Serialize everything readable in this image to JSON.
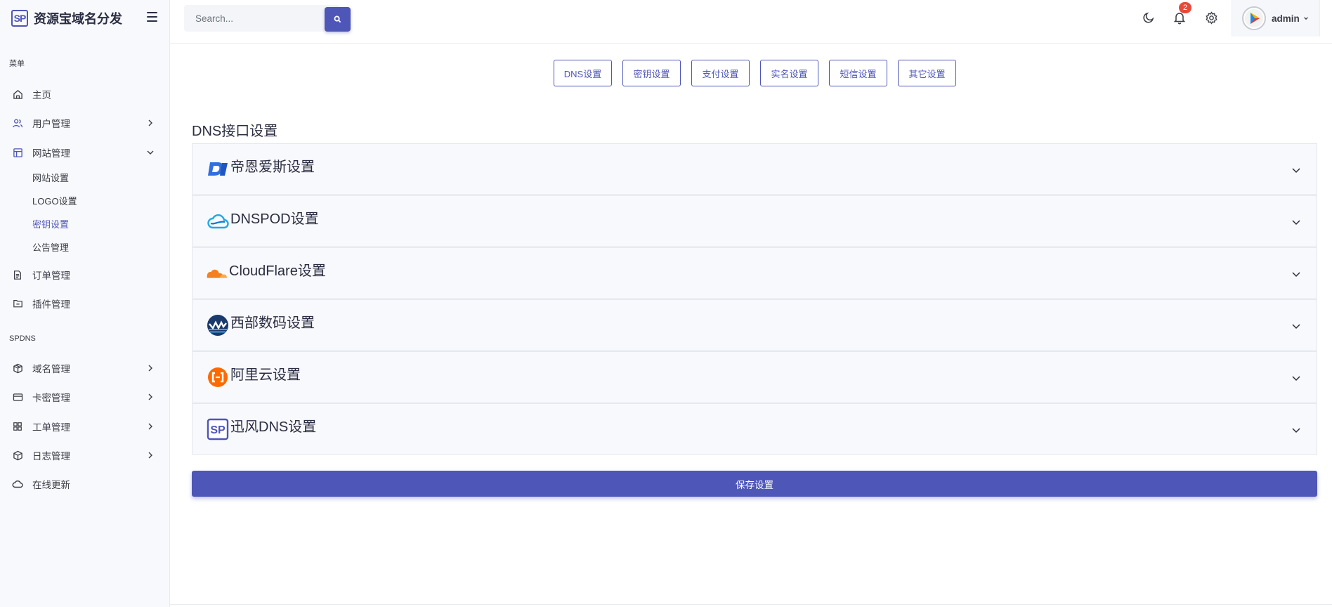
{
  "brand": {
    "logo_text": "SP",
    "title": "资源宝域名分发"
  },
  "sidebar": {
    "section_menu": "菜单",
    "section_spdns": "SPDNS",
    "items": {
      "home": "主页",
      "users": "用户管理",
      "site": "网站管理",
      "orders": "订单管理",
      "plugins": "插件管理",
      "domains": "域名管理",
      "cards": "卡密管理",
      "tickets": "工单管理",
      "logs": "日志管理",
      "update": "在线更新"
    },
    "site_sub": {
      "site_settings": "网站设置",
      "logo_settings": "LOGO设置",
      "key_settings": "密钥设置",
      "notice": "公告管理"
    }
  },
  "header": {
    "search_placeholder": "Search...",
    "notification_count": "2",
    "username": "admin"
  },
  "tabs": [
    "DNS设置",
    "密钥设置",
    "支付设置",
    "实名设置",
    "短信设置",
    "其它设置"
  ],
  "section_title": "DNS接口设置",
  "providers": [
    "帝恩爱斯设置",
    "DNSPOD设置",
    "CloudFlare设置",
    "西部数码设置",
    "阿里云设置",
    "迅风DNS设置"
  ],
  "provider_logos": [
    "dns-la-logo-icon",
    "dnspod-cloud-icon",
    "cloudflare-cloud-icon",
    "west-cn-logo-icon",
    "aliyun-logo-icon",
    "sp-logo-icon"
  ],
  "save_label": "保存设置",
  "colors": {
    "accent": "#4e56b8",
    "badge": "#e74a3b",
    "sidebar_bg": "#f8f9fc"
  }
}
